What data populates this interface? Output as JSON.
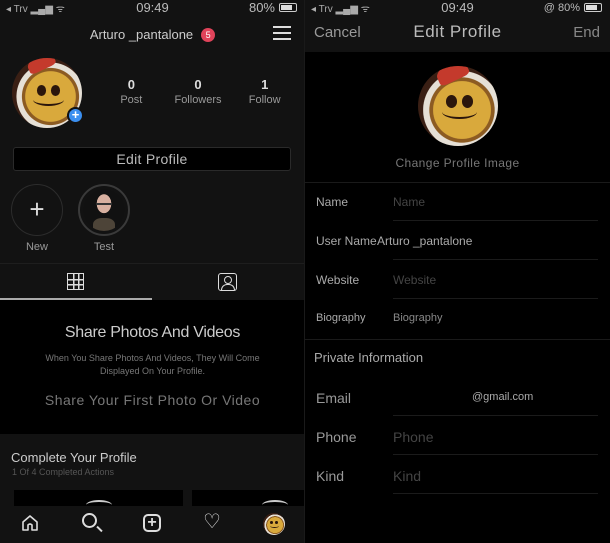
{
  "left": {
    "status_bar": {
      "carrier": "Trv",
      "time": "09:49",
      "battery": "80%"
    },
    "header": {
      "username": "Arturo _pantalone",
      "notification_count": "5"
    },
    "profile": {
      "stats": [
        {
          "value": "0",
          "label": "Post"
        },
        {
          "value": "0",
          "label": "Followers"
        },
        {
          "value": "1",
          "label": "Follow"
        }
      ],
      "edit_profile_label": "Edit Profile",
      "add_photo_glyph": "+"
    },
    "highlights": [
      {
        "label": "New",
        "icon": "plus-icon"
      },
      {
        "label": "Test",
        "icon": "avatar"
      }
    ],
    "tabs": [
      {
        "name": "grid",
        "icon": "grid-icon",
        "active": true
      },
      {
        "name": "tagged",
        "icon": "tagged-person-icon",
        "active": false
      }
    ],
    "empty_state": {
      "title": "Share Photos And Videos",
      "description": "When You Share Photos And Videos, They Will Come Displayed On Your Profile.",
      "cta": "Share Your First Photo Or Video"
    },
    "complete_profile": {
      "title": "Complete Your Profile",
      "subtitle": "1 Of 4 Completed Actions"
    },
    "tab_bar": [
      {
        "name": "home",
        "icon": "home-icon"
      },
      {
        "name": "search",
        "icon": "search-icon"
      },
      {
        "name": "new-post",
        "icon": "add-square-icon",
        "glyph": "+"
      },
      {
        "name": "activity",
        "icon": "heart-icon",
        "glyph": "♡"
      },
      {
        "name": "profile",
        "icon": "avatar"
      }
    ]
  },
  "right": {
    "status_bar": {
      "carrier": "Trv",
      "time": "09:49",
      "battery": "80%",
      "extra": "@"
    },
    "header": {
      "cancel": "Cancel",
      "title": "Edit Profile",
      "done": "End"
    },
    "change_image_label": "Change Profile Image",
    "fields": [
      {
        "label": "Name",
        "value": "",
        "placeholder": "Name"
      },
      {
        "label": "User Name",
        "value": "Arturo _pantalone",
        "placeholder": ""
      },
      {
        "label": "Website",
        "value": "",
        "placeholder": "Website"
      },
      {
        "label": "Biography",
        "value": "",
        "placeholder": "Biography"
      }
    ],
    "private_section_title": "Private Information",
    "private_fields": [
      {
        "label": "Email",
        "value": "@gmail.com",
        "placeholder": ""
      },
      {
        "label": "Phone",
        "value": "",
        "placeholder": "Phone"
      },
      {
        "label": "Kind",
        "value": "",
        "placeholder": "Kind"
      }
    ]
  }
}
